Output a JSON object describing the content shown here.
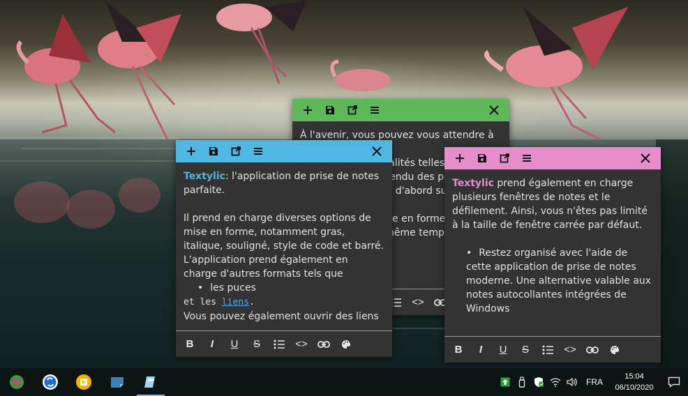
{
  "colors": {
    "note_body": "#333333",
    "green_bar": "#5db85a",
    "blue_bar": "#4fb7e2",
    "pink_bar": "#e58ecb",
    "blue_brand": "#4fb7e2",
    "pink_brand": "#e58ecb",
    "link": "#4ea8e6",
    "taskbar": "#0e1414"
  },
  "toolbar_icons": [
    "plus-icon",
    "save-icon",
    "open-external-icon",
    "menu-icon",
    "close-icon"
  ],
  "format_tools": [
    "bold",
    "italic",
    "underline",
    "strikethrough",
    "bullet-list",
    "code",
    "link",
    "palette"
  ],
  "format_labels": {
    "bold": "B",
    "italic": "I",
    "underline": "U",
    "strike": "S",
    "code": "<>"
  },
  "green_note": {
    "line1": "À l'avenir, vous pouvez vous attendre à voir",
    "line2": "d'autres fonctionnalités telles que",
    "line3": "l'amélioration du rendu des polices",
    "line4": "(en se concentrant d'abord sur l'affichage",
    "line5": "des options de mise en forme et",
    "line6": "des liens dans le même temps)"
  },
  "blue_note": {
    "brand": "Textylic",
    "p1_rest": ": l'application de prise de notes parfaite.",
    "p2": "Il prend en charge diverses options de mise en forme, notamment gras, italique, souligné, style de code et barré. L'application prend également en charge d'autres formats tels que",
    "bullet": "les puces",
    "mono_text": "et les ",
    "link_text": "liens",
    "mono_end": ".",
    "last_line": " Vous pouvez également ouvrir des liens"
  },
  "pink_note": {
    "brand": "Textylic",
    "p1_rest": " prend également en charge plusieurs fenêtres de notes et le défilement. Ainsi, vous n'êtes pas limité à la taille de fenêtre carrée par défaut.",
    "bullet": "Restez organisé avec l'aide de cette application de prise de notes moderne. Une alternative valable aux notes autocollantes intégrées de Windows"
  },
  "taskbar": {
    "apps": [
      "grid-app-icon",
      "sync-app-icon",
      "media-player-icon",
      "sticky-notes-icon",
      "textylic-icon"
    ],
    "lang": "FRA",
    "time": "15:04",
    "date": "06/10/2020"
  }
}
